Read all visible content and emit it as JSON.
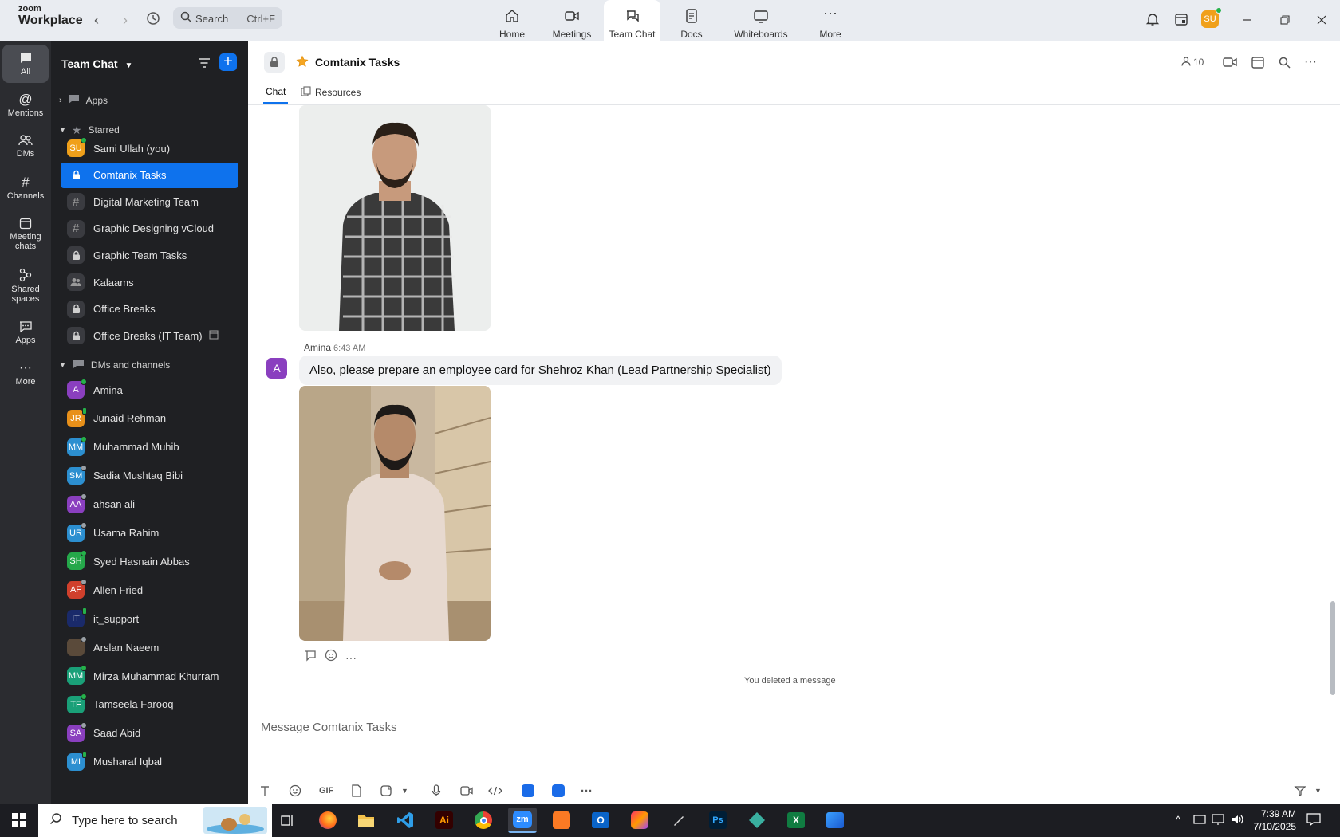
{
  "app": {
    "brand_line1": "zoom",
    "brand_line2": "Workplace",
    "search_label": "Search",
    "search_shortcut": "Ctrl+F",
    "user_initials": "SU"
  },
  "tabs": [
    {
      "label": "Home",
      "icon": "home-icon"
    },
    {
      "label": "Meetings",
      "icon": "video-icon"
    },
    {
      "label": "Team Chat",
      "icon": "chat-icon",
      "active": true
    },
    {
      "label": "Docs",
      "icon": "doc-icon"
    },
    {
      "label": "Whiteboards",
      "icon": "whiteboard-icon"
    },
    {
      "label": "More",
      "icon": "more-icon"
    }
  ],
  "rail": [
    {
      "label": "All",
      "active": true
    },
    {
      "label": "Mentions"
    },
    {
      "label": "DMs"
    },
    {
      "label": "Channels"
    },
    {
      "label": "Meeting chats"
    },
    {
      "label": "Shared spaces"
    },
    {
      "label": "Apps"
    },
    {
      "label": "More"
    }
  ],
  "sidebar": {
    "title": "Team Chat",
    "sections": {
      "apps": "Apps",
      "starred": "Starred",
      "dms": "DMs and channels"
    },
    "starred": [
      {
        "name": "Sami Ullah (you)",
        "initials": "SU",
        "color": "#f0a01a",
        "status": "green"
      },
      {
        "name": "Comtanix Tasks",
        "glyph": "lock",
        "active": true
      },
      {
        "name": "Digital Marketing Team",
        "glyph": "hash"
      },
      {
        "name": "Graphic Designing vCloud",
        "glyph": "hash"
      },
      {
        "name": "Graphic Team Tasks",
        "glyph": "lock"
      },
      {
        "name": "Kalaams",
        "glyph": "group"
      },
      {
        "name": "Office Breaks",
        "glyph": "lock"
      },
      {
        "name": "Office Breaks (IT Team)",
        "glyph": "lock"
      }
    ],
    "dms": [
      {
        "name": "Amina",
        "initials": "A",
        "color": "#8a3fbf",
        "status": "green"
      },
      {
        "name": "Junaid Rehman",
        "initials": "JR",
        "color": "#e8901a",
        "status": "phone"
      },
      {
        "name": "Muhammad Muhib",
        "initials": "MM",
        "color": "#2c8fd0",
        "status": "green"
      },
      {
        "name": "Sadia Mushtaq Bibi",
        "initials": "SM",
        "color": "#2c8fd0",
        "status": "grey"
      },
      {
        "name": "ahsan ali",
        "initials": "AA",
        "color": "#8a3fbf",
        "status": "grey"
      },
      {
        "name": "Usama Rahim",
        "initials": "UR",
        "color": "#2c8fd0",
        "status": "grey"
      },
      {
        "name": "Syed Hasnain Abbas",
        "initials": "SH",
        "color": "#25a84a",
        "status": "green"
      },
      {
        "name": "Allen Fried",
        "initials": "AF",
        "color": "#d0402c",
        "status": "grey"
      },
      {
        "name": "it_support",
        "initials": "IT",
        "color": "#1a2a6a",
        "status": "phone"
      },
      {
        "name": "Arslan Naeem",
        "initials": "",
        "color": "#5a4a3a",
        "status": "grey"
      },
      {
        "name": "Mirza Muhammad Khurram",
        "initials": "MM",
        "color": "#1aa078",
        "status": "green"
      },
      {
        "name": "Tamseela Farooq",
        "initials": "TF",
        "color": "#1aa078",
        "status": "green"
      },
      {
        "name": "Saad Abid",
        "initials": "SA",
        "color": "#8a3fbf",
        "status": "grey"
      },
      {
        "name": "Musharaf Iqbal",
        "initials": "MI",
        "color": "#2c8fd0",
        "status": "phone"
      }
    ]
  },
  "channel": {
    "title": "Comtanix Tasks",
    "member_count": "10",
    "tabs": [
      "Chat",
      "Resources"
    ]
  },
  "messages": {
    "sender": "Amina",
    "time": "6:43 AM",
    "avatar_initial": "A",
    "text": "Also, please prepare an employee card for Shehroz Khan (Lead Partnership Specialist)",
    "deleted_notice": "You deleted a message"
  },
  "composer": {
    "placeholder": "Message Comtanix Tasks",
    "gif_label": "GIF"
  },
  "taskbar": {
    "search_placeholder": "Type here to search",
    "time": "7:39 AM",
    "date": "7/10/2025"
  }
}
